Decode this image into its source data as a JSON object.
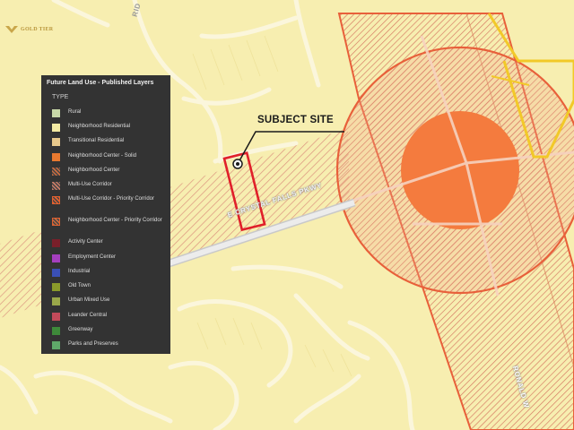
{
  "logo": {
    "text": "GOLD TIER",
    "color": "#b8953a"
  },
  "colors": {
    "base": "#f7eeb0",
    "hatch": "#d98b7a",
    "corridor_border": "#e8603a",
    "center": "#f47b3e",
    "subject_outline": "#e0202a",
    "yellow_boundary": "#f2c928",
    "street": "#fbf6dc"
  },
  "legend": {
    "title": "Future Land Use - Published Layers",
    "subtitle": "TYPE",
    "items": [
      {
        "label": "Rural",
        "color": "#c8d8a8",
        "icon": "rural-swatch"
      },
      {
        "label": "Neighborhood Residential",
        "color": "#f3eaa3",
        "icon": "neighborhood-residential-swatch"
      },
      {
        "label": "Transitional Residential",
        "color": "#e8c98c",
        "icon": "transitional-residential-swatch"
      },
      {
        "label": "Neighborhood Center - Solid",
        "color": "#e8792f",
        "icon": "neighborhood-center-solid-swatch"
      },
      {
        "label": "Neighborhood Center",
        "color": "#c76a3f",
        "icon": "neighborhood-center-hatched-swatch"
      },
      {
        "label": "Multi-Use Corridor",
        "color": "#c77a66",
        "icon": "multi-use-corridor-swatch"
      },
      {
        "label": "Multi-Use Corridor - Priority Corridor",
        "color": "#e0602f",
        "icon": "multi-use-corridor-priority-swatch"
      },
      {
        "label": "Neighborhood Center - Priority Corridor",
        "color": "#c76a3f",
        "icon": "neighborhood-center-priority-swatch"
      },
      {
        "label": "Activity Center",
        "color": "#7a1f2a",
        "icon": "activity-center-swatch"
      },
      {
        "label": "Employment Center",
        "color": "#a53fbf",
        "icon": "employment-center-swatch"
      },
      {
        "label": "Industrial",
        "color": "#3a4fb5",
        "icon": "industrial-swatch"
      },
      {
        "label": "Old Town",
        "color": "#8a9a2a",
        "icon": "old-town-swatch"
      },
      {
        "label": "Urban Mixed Use",
        "color": "#9aa84a",
        "icon": "urban-mixed-use-swatch"
      },
      {
        "label": "Leander Central",
        "color": "#c24a5a",
        "icon": "leander-central-swatch"
      },
      {
        "label": "Greenway",
        "color": "#3e8a3a",
        "icon": "greenway-swatch"
      },
      {
        "label": "Parks and Preserves",
        "color": "#5fa86a",
        "icon": "parks-and-preserves-swatch"
      }
    ]
  },
  "map": {
    "subject_label": "SUBJECT SITE",
    "roads": {
      "crystal_falls": "E CRYSTAL FALLS PKWY",
      "top_street": "RID",
      "ronald": "RONALD W"
    }
  }
}
